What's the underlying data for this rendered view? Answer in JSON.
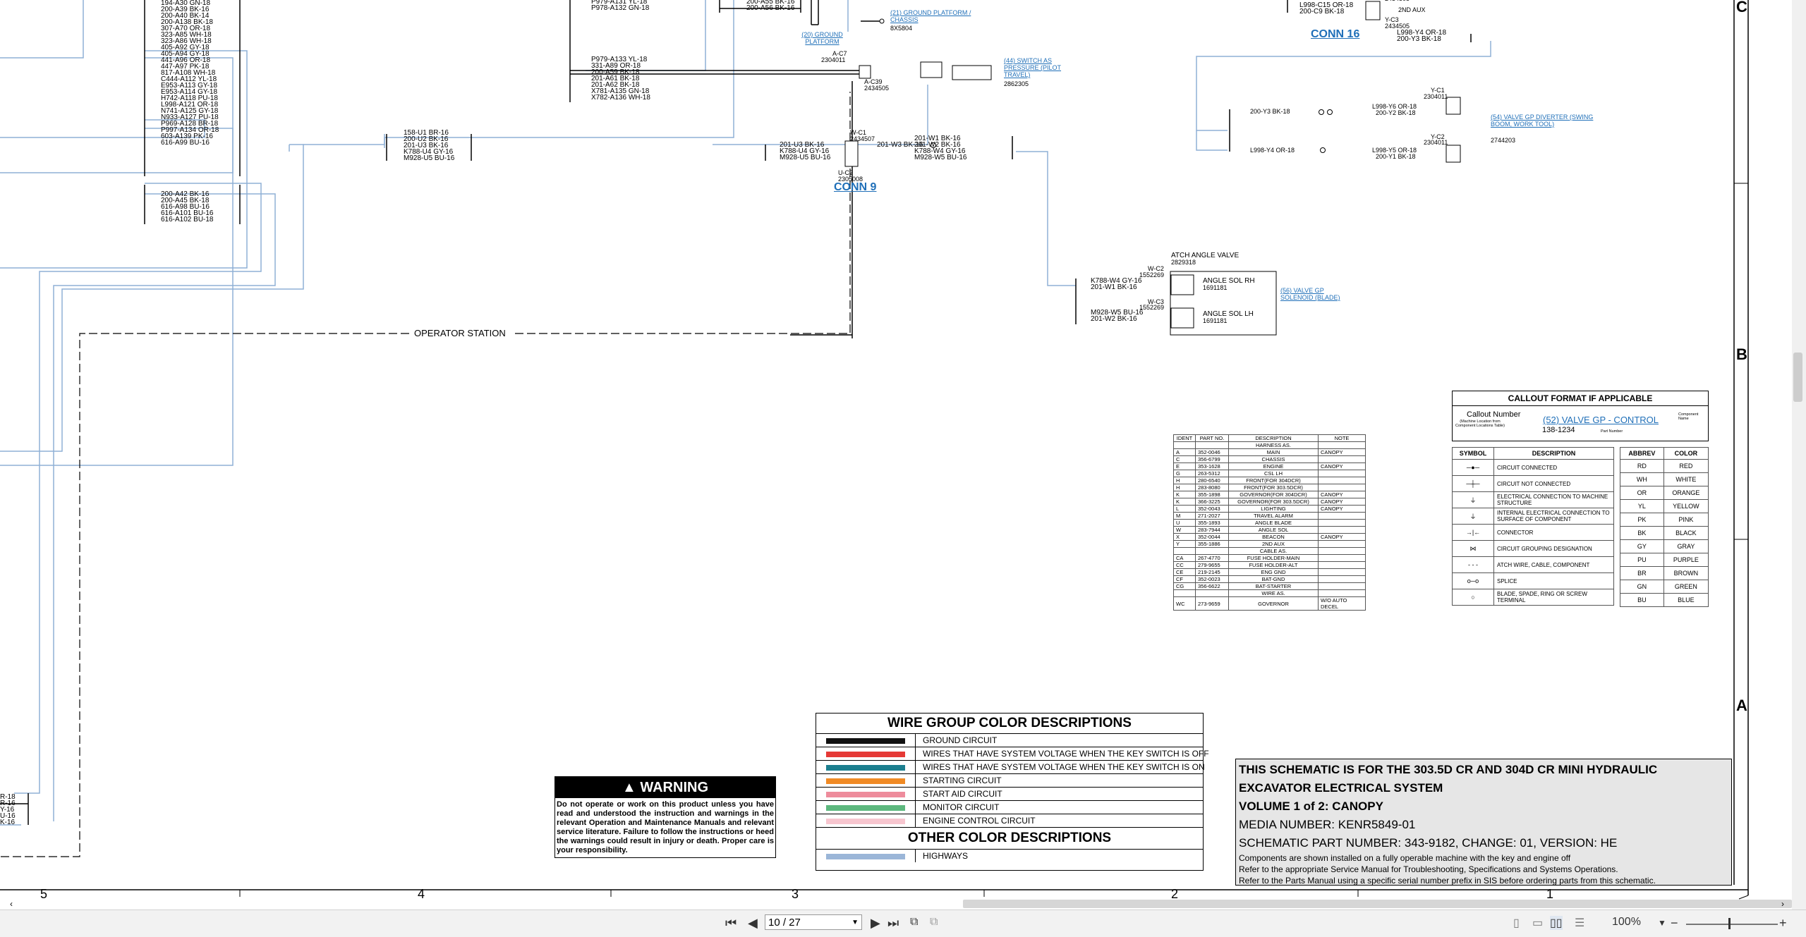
{
  "viewer": {
    "first_page_icon": "first-page-icon",
    "prev_page_icon": "previous-page-icon",
    "page_value": "10 / 27",
    "next_page_icon": "next-page-icon",
    "last_page_icon": "last-page-icon",
    "zoom_value": "100%",
    "zoom_out": "−",
    "zoom_in": "+"
  },
  "schematic": {
    "connectors": [
      "CONN 9",
      "CONN 16"
    ],
    "operator_station": "OPERATOR STATION",
    "zones": [
      "C",
      "B",
      "A"
    ],
    "columns": [
      "5",
      "4",
      "3",
      "2",
      "1"
    ],
    "left_group_1": [
      "194-A30  GN-18",
      "200-A39  BK-16",
      "200-A40  BK-14",
      "200-A138  BK-18",
      "307-A70  OR-18",
      "323-A85  WH-18",
      "323-A86  WH-18",
      "405-A92  GY-18",
      "405-A94  GY-18",
      "441-A96  OR-18",
      "447-A97  PK-18",
      "817-A108  WH-18",
      "C444-A112  YL-18",
      "E953-A113  GY-18",
      "E953-A114  GY-18",
      "H742-A118  PU-18",
      "L998-A121  OR-18",
      "N741-A125  GY-18",
      "N933-A127  PU-18",
      "P969-A128  BR-18",
      "P997-A134  OR-18",
      "603-A139  PK-16",
      "616-A99  BU-16"
    ],
    "left_group_2": [
      "200-A42  BK-16",
      "200-A45  BK-18",
      "616-A98  BU-16",
      "616-A101  BU-16",
      "616-A102  BU-18"
    ],
    "top_group": [
      "P979-A131  YL-18",
      "P978-A132  GN-18"
    ],
    "group_a": [
      "P979-A133  YL-18",
      "331-A89  OR-18",
      "200-A59  BK-18",
      "201-A61  BK-18",
      "201-A62  BK-18",
      "X781-A135  GN-18",
      "X782-A136  WH-18"
    ],
    "group_top_mid": [
      "200-A55  BK-16",
      "200-A56  BK-16"
    ],
    "group_u": [
      "158-U1  BR-16",
      "200-U2  BK-16",
      "201-U3  BK-16",
      "K788-U4  GY-16",
      "M928-U5  BU-16"
    ],
    "group_w_left": [
      "201-U3  BK-16",
      "K788-U4  GY-16",
      "M928-U5  BU-16"
    ],
    "group_w_right_a": [
      "201-W3  BK-16"
    ],
    "group_w_right_b": [
      "201-W1  BK-16",
      "201-W2  BK-16",
      "K788-W4  GY-16",
      "M928-W5  BU-16"
    ],
    "group_angle": [
      "K788-W4  GY-16",
      "201-W1  BK-16",
      "M928-W5  BU-16",
      "201-W2  BK-16"
    ],
    "conn16_left": [
      "L998-C15  OR-18",
      "200-C9  BK-18"
    ],
    "conn16_right": [
      "L998-Y4  OR-18",
      "200-Y3  BK-18"
    ],
    "conn16_y3": "200-Y3  BK-18",
    "conn16_y4": "L998-Y4  OR-18",
    "conn16_y6": "L998-Y6  OR-18",
    "conn16_y2": "200-Y2  BK-18",
    "conn16_y5": "L998-Y5  OR-18",
    "conn16_y1": "200-Y1  BK-18",
    "labels": {
      "yc3": "Y-C3",
      "yc3_pn": "2434505",
      "top_pn": "2434505",
      "aux": "2ND AUX",
      "ac7": "A-C7",
      "ac7_pn": "2304011",
      "ac39": "A-C39",
      "ac39_pn": "2434505",
      "wc1": "W-C1",
      "wc1_pn": "2434507",
      "uc2": "U-C2",
      "uc2_pn": "2305008",
      "wc2": "W-C2",
      "wc2_pn": "1552269",
      "wc3": "W-C3",
      "wc3_pn": "1552269",
      "atch": "ATCH ANGLE VALVE",
      "atch_pn": "2829318",
      "sol_rh": "ANGLE SOL RH",
      "sol_rh_pn": "1691181",
      "sol_lh": "ANGLE SOL LH",
      "sol_lh_pn": "1691181",
      "yc1": "Y-C1",
      "yc1_pn": "2304011",
      "yc2": "Y-C2",
      "yc2_pn": "2304011",
      "pn_8x": "8X5804",
      "pn_sw": "2862305",
      "pn_div": "2744203"
    },
    "callouts": {
      "ground_chassis": "(21) GROUND PLATFORM / CHASSIS",
      "ground_platform": "(20) GROUND PLATFORM",
      "switch": "(44) SWITCH AS PRESSURE (PILOT TRAVEL)",
      "diverter": "(54) VALVE GP DIVERTER (SWING BOOM, WORK TOOL)",
      "blade": "(56) VALVE GP SOLENOID (BLADE)"
    },
    "callout_format": {
      "title": "CALLOUT FORMAT IF APPLICABLE",
      "callout_number": "Callout Number",
      "callout_note": "(Machine Location from Component Locations Table)",
      "link_example": "(52) VALVE GP - CONTROL",
      "component_name": "Component Name",
      "part_number": "138-1234",
      "part_number_label": "Part Number"
    },
    "ident_table": {
      "headers": [
        "IDENT",
        "PART NO.",
        "DESCRIPTION",
        "NOTE"
      ],
      "rows": [
        [
          "",
          "",
          "HARNESS AS.",
          ""
        ],
        [
          "A",
          "352-0046",
          "MAIN",
          "CANOPY"
        ],
        [
          "C",
          "356-6799",
          "CHASSIS",
          ""
        ],
        [
          "E",
          "353-1628",
          "ENGINE",
          "CANOPY"
        ],
        [
          "G",
          "263-5312",
          "CSL LH",
          ""
        ],
        [
          "H",
          "280-6540",
          "FRONT(FOR 304DCR)",
          ""
        ],
        [
          "H",
          "283-8080",
          "FRONT(FOR 303.5DCR)",
          ""
        ],
        [
          "K",
          "355-1898",
          "GOVERNOR(FOR 304DCR)",
          "CANOPY"
        ],
        [
          "K",
          "366-3225",
          "GOVERNOR(FOR 303.5DCR)",
          "CANOPY"
        ],
        [
          "L",
          "352-0043",
          "LIGHTING",
          "CANOPY"
        ],
        [
          "M",
          "271-2027",
          "TRAVEL ALARM",
          ""
        ],
        [
          "U",
          "355-1893",
          "ANGLE BLADE",
          ""
        ],
        [
          "W",
          "283-7944",
          "ANGLE SOL",
          ""
        ],
        [
          "X",
          "352-0044",
          "BEACON",
          "CANOPY"
        ],
        [
          "Y",
          "355-1886",
          "2ND AUX",
          ""
        ],
        [
          "",
          "",
          "CABLE AS.",
          ""
        ],
        [
          "CA",
          "267-4770",
          "FUSE HOLDER-MAIN",
          ""
        ],
        [
          "CC",
          "279-9655",
          "FUSE HOLDER-ALT",
          ""
        ],
        [
          "CE",
          "219-2145",
          "ENG GND",
          ""
        ],
        [
          "CF",
          "352-0023",
          "BAT-GND",
          ""
        ],
        [
          "CG",
          "356-6622",
          "BAT-STARTER",
          ""
        ],
        [
          "",
          "",
          "WIRE AS.",
          ""
        ],
        [
          "WC",
          "273-9659",
          "GOVERNOR",
          "W/O AUTO DECEL"
        ]
      ]
    },
    "symbol_table": {
      "headers": [
        "SYMBOL",
        "DESCRIPTION"
      ],
      "rows": [
        [
          "circuit-connected-icon",
          "CIRCUIT CONNECTED"
        ],
        [
          "circuit-not-connected-icon",
          "CIRCUIT NOT CONNECTED"
        ],
        [
          "electrical-connection-icon",
          "ELECTRICAL CONNECTION TO MACHINE STRUCTURE"
        ],
        [
          "internal-connection-icon",
          "INTERNAL ELECTRICAL CONNECTION TO SURFACE OF COMPONENT"
        ],
        [
          "connector-icon",
          "CONNECTOR"
        ],
        [
          "grouping-icon",
          "CIRCUIT GROUPING DESIGNATION"
        ],
        [
          "dashed-line-icon",
          "ATCH WIRE, CABLE, COMPONENT"
        ],
        [
          "splice-icon",
          "SPLICE"
        ],
        [
          "terminal-icon",
          "BLADE, SPADE, RING OR SCREW TERMINAL"
        ]
      ]
    },
    "abbrev_table": {
      "headers": [
        "ABBREV",
        "COLOR"
      ],
      "rows": [
        [
          "RD",
          "RED"
        ],
        [
          "WH",
          "WHITE"
        ],
        [
          "OR",
          "ORANGE"
        ],
        [
          "YL",
          "YELLOW"
        ],
        [
          "PK",
          "PINK"
        ],
        [
          "BK",
          "BLACK"
        ],
        [
          "GY",
          "GRAY"
        ],
        [
          "PU",
          "PURPLE"
        ],
        [
          "BR",
          "BROWN"
        ],
        [
          "GN",
          "GREEN"
        ],
        [
          "BU",
          "BLUE"
        ]
      ]
    },
    "wire_group": {
      "title": "WIRE GROUP COLOR DESCRIPTIONS",
      "rows": [
        {
          "color": "#111111",
          "label": "GROUND CIRCUIT"
        },
        {
          "color": "#e53935",
          "label": "WIRES THAT HAVE SYSTEM VOLTAGE WHEN THE KEY SWITCH IS OFF"
        },
        {
          "color": "#1c7f8f",
          "label": "WIRES THAT HAVE SYSTEM VOLTAGE WHEN THE KEY SWITCH IS ON"
        },
        {
          "color": "#f08a24",
          "label": "STARTING CIRCUIT"
        },
        {
          "color": "#ee8c9c",
          "label": "START AID CIRCUIT"
        },
        {
          "color": "#5db87e",
          "label": "MONITOR CIRCUIT"
        },
        {
          "color": "#f7c6cf",
          "label": "ENGINE CONTROL CIRCUIT"
        }
      ],
      "other_title": "OTHER COLOR DESCRIPTIONS",
      "other_rows": [
        {
          "color": "#9bb6d8",
          "label": "HIGHWAYS"
        }
      ]
    },
    "warning": {
      "title": "WARNING",
      "text": "Do not operate or work on this product unless you have read and understood the instruction and warnings in the relevant Operation and Maintenance Manuals and relevant service literature. Failure to follow the instructions or heed the warnings could result in injury or death. Proper care is your responsibility."
    },
    "title_block": {
      "line1": "THIS SCHEMATIC IS FOR THE 303.5D CR AND 304D CR MINI HYDRAULIC",
      "line2": "EXCAVATOR ELECTRICAL SYSTEM",
      "line3": "VOLUME 1 of 2: CANOPY",
      "line4": "MEDIA NUMBER: KENR5849-01",
      "line5": "SCHEMATIC PART NUMBER: 343-9182, CHANGE: 01, VERSION: HE",
      "line6": "Components are shown installed on a fully operable machine with the key and engine off",
      "line7": "Refer to the appropriate Service Manual for Troubleshooting, Specifications and Systems Operations.",
      "line8": "Refer to the Parts Manual using a specific serial number prefix in SIS before ordering parts from this schematic."
    },
    "edge_labels": [
      "R-18",
      "R-16",
      "Y-16",
      "U-16",
      "K-16"
    ]
  },
  "colors": {
    "highway": "#8fb0d6",
    "link": "#1f6fb8",
    "title_bg": "#e6e6e6"
  }
}
